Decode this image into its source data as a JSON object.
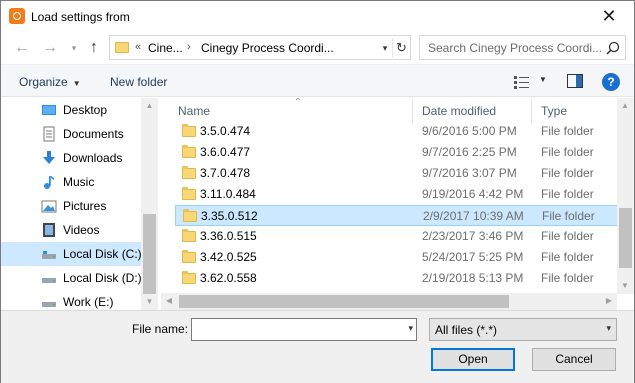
{
  "window": {
    "title": "Load settings from",
    "close_glyph": "✕"
  },
  "nav": {
    "back_glyph": "←",
    "forward_glyph": "→",
    "recent_glyph": "▾",
    "up_glyph": "↑"
  },
  "address": {
    "overflow": "«",
    "parts": [
      "Cine...",
      "Cinegy Process Coordi..."
    ],
    "separator": "›",
    "dropdown_glyph": "▾",
    "refresh_glyph": "↻"
  },
  "search": {
    "placeholder": "Search Cinegy Process Coordi..."
  },
  "toolbar": {
    "organize_label": "Organize",
    "caret": "▼",
    "new_folder_label": "New folder",
    "view_caret": "▼",
    "help_label": "?"
  },
  "navpane": {
    "items": [
      {
        "label": "Desktop",
        "icon": "desktop-icon",
        "selected": false
      },
      {
        "label": "Documents",
        "icon": "documents-icon",
        "selected": false
      },
      {
        "label": "Downloads",
        "icon": "downloads-icon",
        "selected": false
      },
      {
        "label": "Music",
        "icon": "music-icon",
        "selected": false
      },
      {
        "label": "Pictures",
        "icon": "pictures-icon",
        "selected": false
      },
      {
        "label": "Videos",
        "icon": "videos-icon",
        "selected": false
      },
      {
        "label": "Local Disk (C:)",
        "icon": "drive-icon",
        "selected": true
      },
      {
        "label": "Local Disk (D:)",
        "icon": "drive-icon",
        "selected": false
      },
      {
        "label": "Work (E:)",
        "icon": "drive-icon",
        "selected": false
      }
    ]
  },
  "columns": {
    "name": "Name",
    "date": "Date modified",
    "type": "Type"
  },
  "files": [
    {
      "name": "3.5.0.474",
      "date": "9/6/2016 5:00 PM",
      "type": "File folder",
      "selected": false
    },
    {
      "name": "3.6.0.477",
      "date": "9/7/2016 2:25 PM",
      "type": "File folder",
      "selected": false
    },
    {
      "name": "3.7.0.478",
      "date": "9/7/2016 3:07 PM",
      "type": "File folder",
      "selected": false
    },
    {
      "name": "3.11.0.484",
      "date": "9/19/2016 4:42 PM",
      "type": "File folder",
      "selected": false
    },
    {
      "name": "3.35.0.512",
      "date": "2/9/2017 10:39 AM",
      "type": "File folder",
      "selected": true
    },
    {
      "name": "3.36.0.515",
      "date": "2/23/2017 3:46 PM",
      "type": "File folder",
      "selected": false
    },
    {
      "name": "3.42.0.525",
      "date": "5/24/2017 5:25 PM",
      "type": "File folder",
      "selected": false
    },
    {
      "name": "3.62.0.558",
      "date": "2/19/2018 5:13 PM",
      "type": "File folder",
      "selected": false
    }
  ],
  "footer": {
    "filename_label": "File name:",
    "filename_value": "",
    "filter_value": "All files (*.*)",
    "open_label": "Open",
    "cancel_label": "Cancel"
  },
  "colors": {
    "accent": "#0078d7",
    "selection": "#cce8ff",
    "folder": "#f8d775"
  }
}
